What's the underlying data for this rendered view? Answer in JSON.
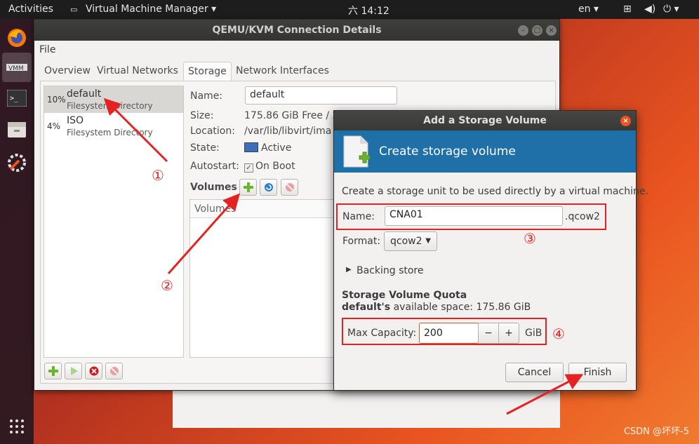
{
  "topbar": {
    "activities": "Activities",
    "app_name": "Virtual Machine Manager",
    "clock": "六 14:12",
    "lang": "en"
  },
  "main_window": {
    "title": "QEMU/KVM Connection Details",
    "menu_file": "File",
    "tabs": [
      "Overview",
      "Virtual Networks",
      "Storage",
      "Network Interfaces"
    ],
    "active_tab": "Storage",
    "pools": [
      {
        "pct": "10%",
        "name": "default",
        "type": "Filesystem Directory"
      },
      {
        "pct": "4%",
        "name": "ISO",
        "type": "Filesystem Directory"
      }
    ],
    "details": {
      "name_label": "Name:",
      "name_value": "default",
      "size_label": "Size:",
      "size_value": "175.86 GiB Free / 20",
      "location_label": "Location:",
      "location_value": "/var/lib/libvirt/ima",
      "state_label": "State:",
      "state_value": "Active",
      "autostart_label": "Autostart:",
      "autostart_value": "On Boot",
      "volumes_label": "Volumes",
      "volumes_col": "Volumes"
    }
  },
  "dialog": {
    "title": "Add a Storage Volume",
    "banner_title": "Create storage volume",
    "description": "Create a storage unit to be used directly by a virtual machine.",
    "name_label": "Name:",
    "name_value": "CNA01",
    "name_suffix": ".qcow2",
    "format_label": "Format:",
    "format_value": "qcow2",
    "backing_store": "Backing store",
    "quota_title": "Storage Volume Quota",
    "pool_name": "default's",
    "available_text": "available space: 175.86 GiB",
    "max_capacity_label": "Max Capacity:",
    "max_capacity_value": "200",
    "unit": "GiB",
    "cancel": "Cancel",
    "finish": "Finish"
  },
  "annotations": [
    "①",
    "②",
    "③",
    "④"
  ],
  "watermark": "CSDN @坏坏-5",
  "colors": {
    "accent": "#e95420",
    "banner": "#1f6fa8",
    "annotation": "#e52222"
  }
}
